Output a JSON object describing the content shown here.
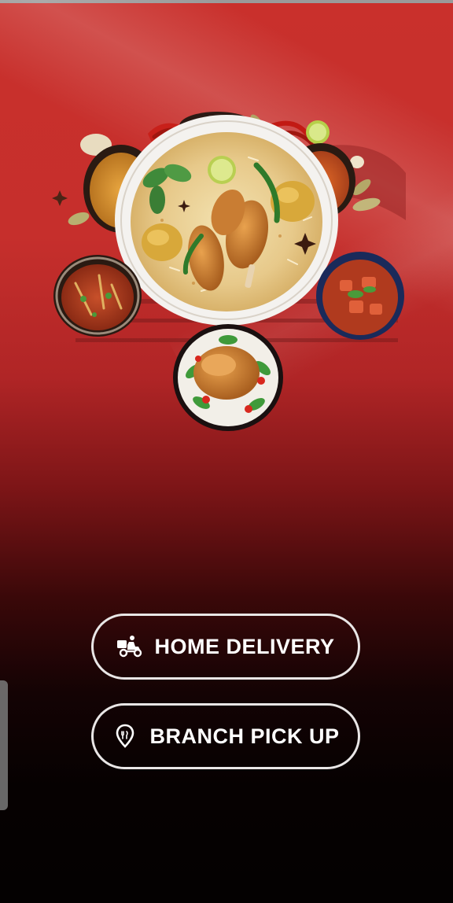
{
  "screen": {
    "background_top": "#c9302c",
    "background_bottom": "#040101",
    "hero_image": "biryani-platter-image"
  },
  "actions": {
    "home_delivery": {
      "label": "HOME DELIVERY",
      "icon": "delivery-scooter-icon"
    },
    "branch_pickup": {
      "label": "BRANCH PICK UP",
      "icon": "location-pin-icon"
    }
  },
  "colors": {
    "button_border": "#e9e6e6",
    "button_text": "#ffffff"
  }
}
